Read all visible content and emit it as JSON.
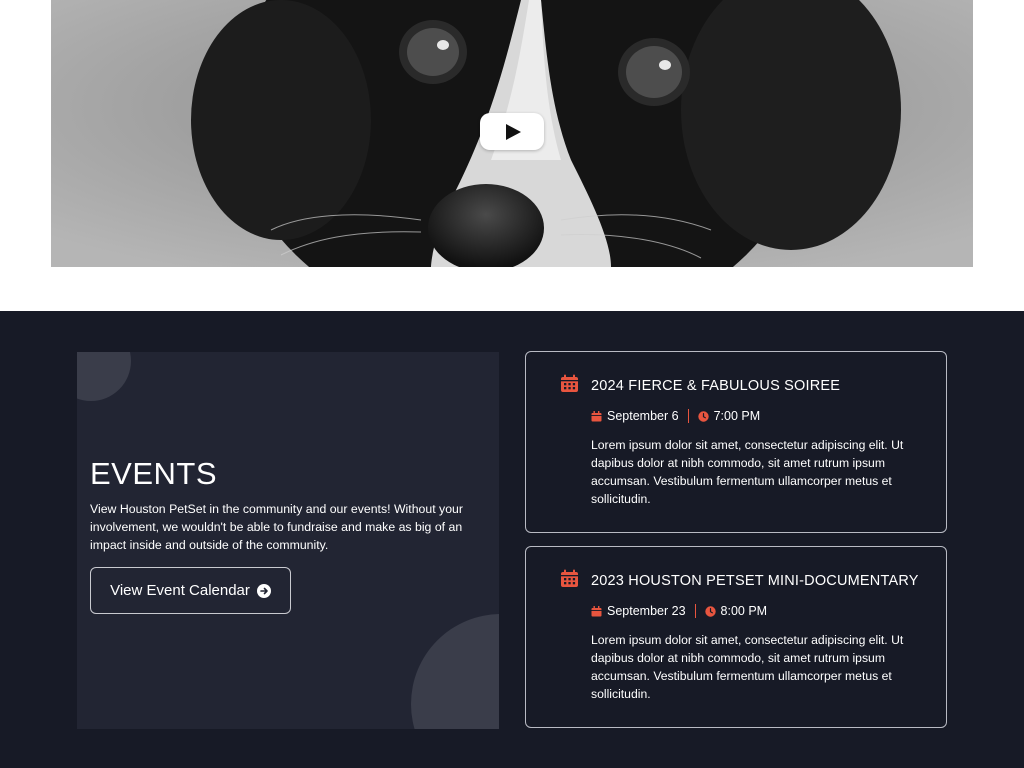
{
  "video": {
    "image_subject": "dog-photo",
    "play_icon": "play-icon"
  },
  "events": {
    "title": "EVENTS",
    "description": "View Houston PetSet in the community and our events! Without your involvement, we wouldn't be able to fundraise and make as big of an impact inside and outside of the community.",
    "calendar_button": "View Event Calendar",
    "items": [
      {
        "title": "2024 FIERCE & FABULOUS SOIREE",
        "date": "September 6",
        "time": "7:00 PM",
        "body": "Lorem ipsum dolor sit amet, consectetur adipiscing elit. Ut dapibus dolor at nibh commodo, sit amet rutrum ipsum accumsan. Vestibulum fermentum ullamcorper metus et sollicitudin."
      },
      {
        "title": "2023 HOUSTON PETSET MINI-DOCUMENTARY",
        "date": "September 23",
        "time": "8:00 PM",
        "body": "Lorem ipsum dolor sit amet, consectetur adipiscing elit. Ut dapibus dolor at nibh commodo, sit amet rutrum ipsum accumsan. Vestibulum fermentum ullamcorper metus et sollicitudin."
      }
    ]
  },
  "colors": {
    "accent": "#e8553f",
    "section_bg": "#171a26",
    "panel_bg": "#222533"
  }
}
